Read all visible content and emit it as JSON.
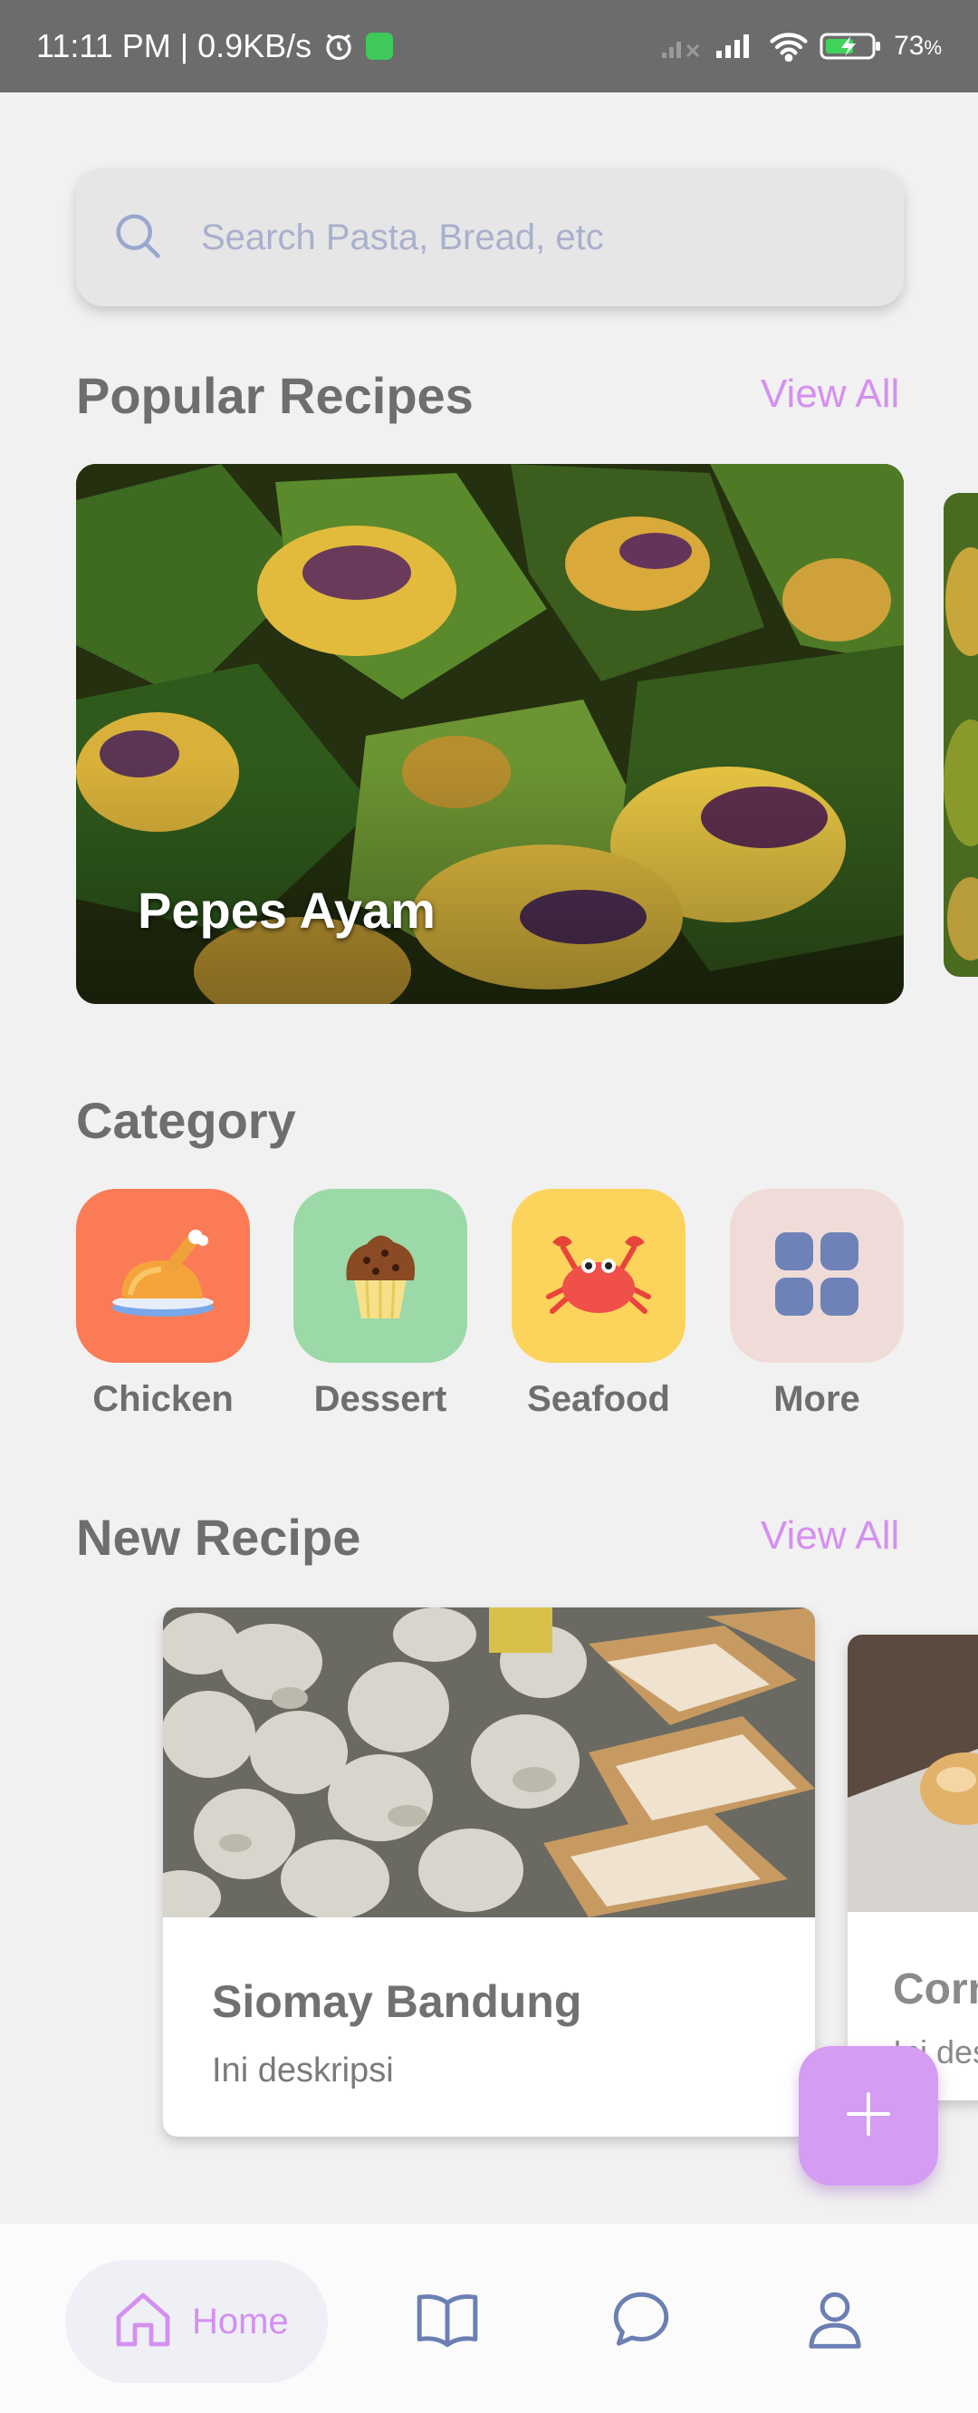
{
  "status_bar": {
    "time_speed": "11:11 PM | 0.9KB/s",
    "battery": "73",
    "battery_unit": "%"
  },
  "search": {
    "placeholder": "Search Pasta, Bread, etc",
    "icon": "search-icon"
  },
  "popular": {
    "title": "Popular Recipes",
    "view_all": "View All",
    "cards": [
      {
        "title": "Pepes Ayam"
      }
    ]
  },
  "category": {
    "title": "Category",
    "items": [
      {
        "label": "Chicken",
        "color": "#fb7b57",
        "icon": "roast-chicken-icon"
      },
      {
        "label": "Dessert",
        "color": "#9bd9a8",
        "icon": "muffin-icon"
      },
      {
        "label": "Seafood",
        "color": "#fcd45c",
        "icon": "crab-icon"
      },
      {
        "label": "More",
        "color": "#efdcd8",
        "icon": "grid-icon"
      }
    ]
  },
  "new_recipe": {
    "title": "New Recipe",
    "view_all": "View All",
    "cards": [
      {
        "name": "Siomay Bandung",
        "description": "Ini deskripsi"
      },
      {
        "name": "Corn",
        "description": "Ini deskripsi"
      }
    ]
  },
  "fab": {
    "icon": "plus-icon"
  },
  "bottom_nav": {
    "items": [
      {
        "label": "Home",
        "icon": "home-icon",
        "active": true
      },
      {
        "label": "",
        "icon": "book-icon"
      },
      {
        "label": "",
        "icon": "chat-bubble-icon"
      },
      {
        "label": "",
        "icon": "user-icon"
      }
    ]
  },
  "colors": {
    "accent": "#d490f0",
    "fab": "#d59cf4",
    "background": "#f1f1f1",
    "nav_icon": "#6b7fb3"
  }
}
